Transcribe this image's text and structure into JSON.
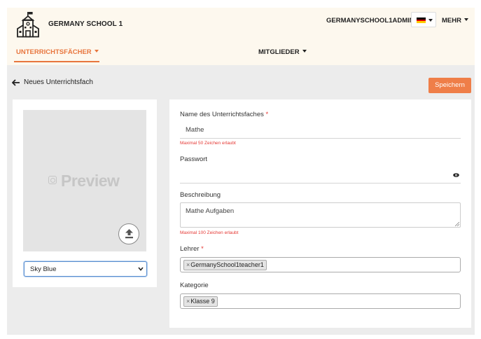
{
  "header": {
    "school_name": "GERMANY SCHOOL 1",
    "user_name": "GERMANYSCHOOL1ADMIN",
    "more_label": "MEHR",
    "language_icon": "germany-flag-icon",
    "nav": {
      "subjects_label": "UNTERRICHTSFÄCHER",
      "members_label": "MITGLIEDER"
    }
  },
  "page": {
    "title": "Neues Unterrichtsfach",
    "save_label": "Speichern"
  },
  "preview": {
    "label": "Preview",
    "color_select_value": "Sky Blue"
  },
  "form": {
    "name_label": "Name des Unterrichtsfaches",
    "name_required_mark": "*",
    "name_value": "Mathe",
    "name_hint": "Maximal 50 Zeichen erlaubt",
    "password_label": "Passwort",
    "description_label": "Beschreibung",
    "description_value": "Mathe Aufgaben",
    "description_hint": "Maximal 100 Zeichen erlaubt",
    "teacher_label": "Lehrer",
    "teacher_required_mark": "*",
    "teacher_tag": "GermanySchool1teacher1",
    "category_label": "Kategorie",
    "category_tag": "Klasse 9",
    "tag_remove_symbol": "×"
  },
  "colors": {
    "accent": "#ef7e48",
    "header_bg": "#fdf8ee",
    "required": "#e53935",
    "page_bg": "#ececec"
  }
}
